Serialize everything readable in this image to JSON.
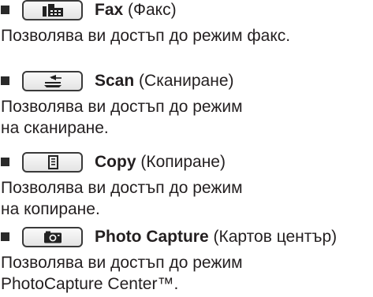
{
  "modes": [
    {
      "button_icon": "fax-icon",
      "title": "Fax",
      "subtitle": "(Факс)",
      "description": [
        "Позволява ви достъп до режим факс."
      ]
    },
    {
      "button_icon": "scan-icon",
      "title": "Scan",
      "subtitle": "(Сканиране)",
      "description": [
        "Позволява ви достъп до режим",
        "на сканиране."
      ]
    },
    {
      "button_icon": "copy-icon",
      "title": "Copy",
      "subtitle": "(Копиране)",
      "description": [
        "Позволява ви достъп до режим",
        "на копиране."
      ]
    },
    {
      "button_icon": "camera-icon",
      "title": "Photo Capture",
      "subtitle": "(Картов център)",
      "description": [
        "Позволява ви достъп до режим",
        "PhotoCapture Center™."
      ]
    }
  ]
}
